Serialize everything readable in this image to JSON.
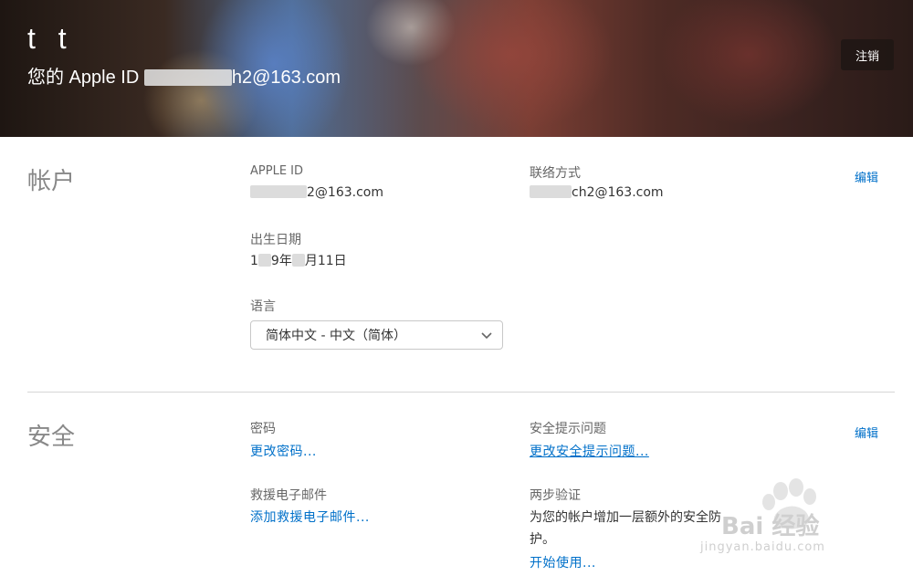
{
  "header": {
    "name": "t t",
    "appleid_prefix": "您的 Apple ID ",
    "appleid_suffix": "h2@163.com",
    "signout_label": "注销"
  },
  "account": {
    "title": "帐户",
    "edit_label": "编辑",
    "apple_id_label": "APPLE ID",
    "apple_id_value_suffix": "2@163.com",
    "contact_label": "联络方式",
    "contact_value_suffix": "ch2@163.com",
    "birthday_label": "出生日期",
    "birthday_p1": "1",
    "birthday_p2": "9年",
    "birthday_p3": "月11日",
    "language_label": "语言",
    "language_selected": "简体中文 - 中文（简体）"
  },
  "security": {
    "title": "安全",
    "edit_label": "编辑",
    "password_label": "密码",
    "password_link": "更改密码...",
    "questions_label": "安全提示问题",
    "questions_link": "更改安全提示问题...",
    "rescue_label": "救援电子邮件",
    "rescue_link": "添加救援电子邮件...",
    "twostep_label": "两步验证",
    "twostep_desc_line1": "为您的帐户增加一层额外的安全防",
    "twostep_desc_line2": "护。",
    "twostep_link": "开始使用..."
  },
  "watermark": {
    "text": "Bai 经验",
    "sub": "jingyan.baidu.com"
  }
}
